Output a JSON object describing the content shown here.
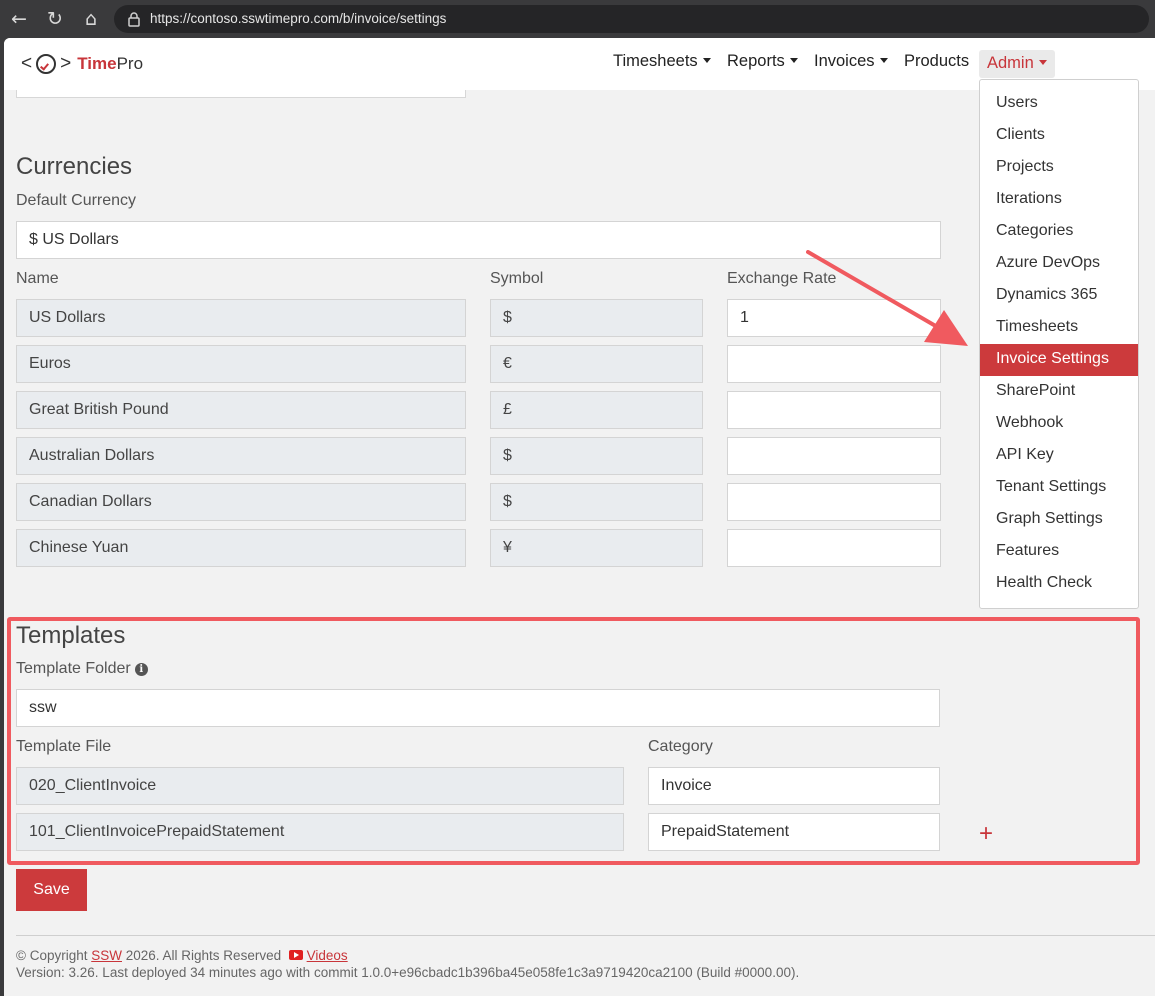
{
  "browser": {
    "url": "https://contoso.sswtimepro.com/b/invoice/settings",
    "back_icon": "←",
    "reload_icon": "↻",
    "home_icon": "⌂"
  },
  "brand": {
    "bracket_left": "<",
    "bracket_right": ">",
    "name_accent": "Time",
    "name_rest": "Pro"
  },
  "nav": {
    "timesheets": "Timesheets",
    "reports": "Reports",
    "invoices": "Invoices",
    "products": "Products",
    "admin": "Admin"
  },
  "admin_menu": {
    "items": [
      "Users",
      "Clients",
      "Projects",
      "Iterations",
      "Categories",
      "Azure DevOps",
      "Dynamics 365",
      "Timesheets",
      "Invoice Settings",
      "SharePoint",
      "Webhook",
      "API Key",
      "Tenant Settings",
      "Graph Settings",
      "Features",
      "Health Check"
    ],
    "active": "Invoice Settings"
  },
  "currencies": {
    "heading": "Currencies",
    "default_label": "Default Currency",
    "default_value": "$ US Dollars",
    "col_name": "Name",
    "col_symbol": "Symbol",
    "col_rate": "Exchange Rate",
    "rows": [
      {
        "name": "US Dollars",
        "symbol": "$",
        "rate": "1"
      },
      {
        "name": "Euros",
        "symbol": "€",
        "rate": ""
      },
      {
        "name": "Great British Pound",
        "symbol": "£",
        "rate": ""
      },
      {
        "name": "Australian Dollars",
        "symbol": "$",
        "rate": ""
      },
      {
        "name": "Canadian Dollars",
        "symbol": "$",
        "rate": ""
      },
      {
        "name": "Chinese Yuan",
        "symbol": "¥",
        "rate": ""
      }
    ]
  },
  "templates": {
    "heading": "Templates",
    "folder_label": "Template Folder",
    "folder_value": "ssw",
    "col_file": "Template File",
    "col_category": "Category",
    "rows": [
      {
        "file": "020_ClientInvoice",
        "category": "Invoice"
      },
      {
        "file": "101_ClientInvoicePrepaidStatement",
        "category": "PrepaidStatement"
      }
    ],
    "add_symbol": "+"
  },
  "save_label": "Save",
  "footer": {
    "copyright_prefix": "© Copyright ",
    "company": "SSW",
    "copyright_suffix": " 2026. All Rights Reserved",
    "videos": "Videos",
    "version": "Version: 3.26. Last deployed 34 minutes ago with commit 1.0.0+e96cbadc1b396ba45e058fe1c3a9719420ca2100 (Build #0000.00)."
  },
  "colors": {
    "accent": "#cc3a3c",
    "highlight": "#f05a5f"
  }
}
